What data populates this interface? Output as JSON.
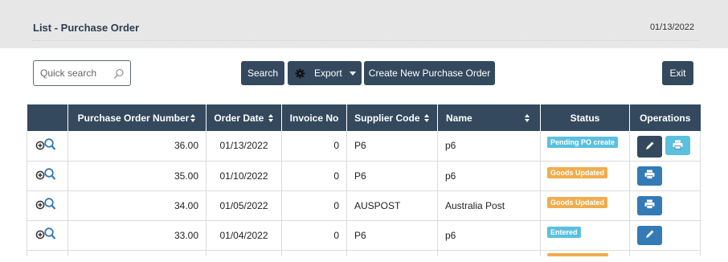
{
  "header": {
    "title": "List - Purchase Order",
    "date": "01/13/2022"
  },
  "toolbar": {
    "search_placeholder": "Quick search",
    "search_label": "Search",
    "export_label": "Export",
    "create_label": "Create New Purchase Order",
    "exit_label": "Exit"
  },
  "table": {
    "columns": [
      "",
      "Purchase Order Number",
      "Order Date",
      "Invoice No",
      "Supplier Code",
      "Name",
      "Status",
      "Operations"
    ],
    "rows": [
      {
        "po_number": "36.00",
        "order_date": "01/13/2022",
        "invoice_no": "0",
        "supplier_code": "P6",
        "name": "p6",
        "status": "Pending PO create",
        "status_color": "#5bc0de",
        "ops": [
          "edit-dark",
          "print-light"
        ]
      },
      {
        "po_number": "35.00",
        "order_date": "01/10/2022",
        "invoice_no": "0",
        "supplier_code": "P6",
        "name": "p6",
        "status": "Goods Updated",
        "status_color": "#f0ad4e",
        "ops": [
          "print-blue"
        ]
      },
      {
        "po_number": "34.00",
        "order_date": "01/05/2022",
        "invoice_no": "0",
        "supplier_code": "AUSPOST",
        "name": "Australia Post",
        "status": "Goods Updated",
        "status_color": "#f0ad4e",
        "ops": [
          "print-blue"
        ]
      },
      {
        "po_number": "33.00",
        "order_date": "01/04/2022",
        "invoice_no": "0",
        "supplier_code": "P6",
        "name": "p6",
        "status": "Entered",
        "status_color": "#5bc0de",
        "ops": [
          "edit-blue"
        ]
      }
    ]
  },
  "colors": {
    "header_bg": "#34495e",
    "accent_blue": "#337ab7",
    "info": "#5bc0de",
    "warning": "#f0ad4e"
  }
}
